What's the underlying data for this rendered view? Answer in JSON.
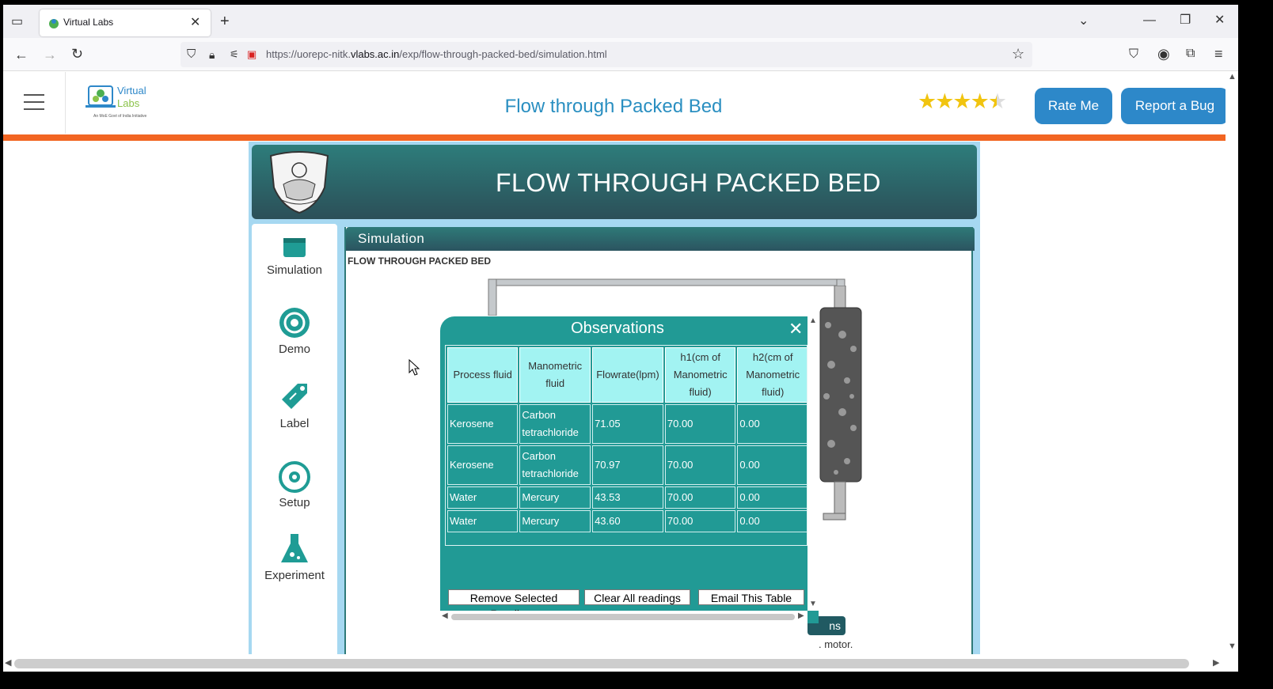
{
  "browser": {
    "tab_title": "Virtual Labs",
    "url_prefix": "https://uorepc-nitk.",
    "url_host": "vlabs.ac.in",
    "url_path": "/exp/flow-through-packed-bed/simulation.html"
  },
  "header": {
    "site_title": "Flow through Packed Bed",
    "logo_text": "Virtual Labs",
    "logo_tagline": "An MoE Govt of India Initiative",
    "rating": 4.5,
    "stars": "★★★★★",
    "rate_button": "Rate Me",
    "bug_button": "Report a Bug"
  },
  "banner": {
    "title": "FLOW THROUGH PACKED BED"
  },
  "sidebar": {
    "items": [
      {
        "label": "Simulation",
        "icon": "window-icon"
      },
      {
        "label": "Demo",
        "icon": "target-icon"
      },
      {
        "label": "Label",
        "icon": "tag-icon"
      },
      {
        "label": "Setup",
        "icon": "gear-cycle-icon"
      },
      {
        "label": "Experiment",
        "icon": "flask-icon"
      }
    ]
  },
  "content": {
    "panel_title": "Simulation",
    "sim_title": "FLOW THROUGH PACKED BED",
    "hidden_button_text": "ns",
    "motor_text": ". motor."
  },
  "modal": {
    "title": "Observations",
    "columns": [
      "Process fluid",
      "Manometric fluid",
      "Flowrate(lpm)",
      "h1(cm of Manometric fluid)",
      "h2(cm of Manometric fluid)"
    ],
    "rows": [
      [
        "Kerosene",
        "Carbon tetrachloride",
        "71.05",
        "70.00",
        "0.00"
      ],
      [
        "Kerosene",
        "Carbon tetrachloride",
        "70.97",
        "70.00",
        "0.00"
      ],
      [
        "Water",
        "Mercury",
        "43.53",
        "70.00",
        "0.00"
      ],
      [
        "Water",
        "Mercury",
        "43.60",
        "70.00",
        "0.00"
      ]
    ],
    "buttons": {
      "remove": "Remove Selected Readings",
      "clear": "Clear All readings",
      "email": "Email This Table"
    }
  },
  "colors": {
    "brand_blue": "#2d88c9",
    "accent_orange": "#f26522",
    "teal": "#219a95",
    "header_cell": "#a2f3f2"
  }
}
